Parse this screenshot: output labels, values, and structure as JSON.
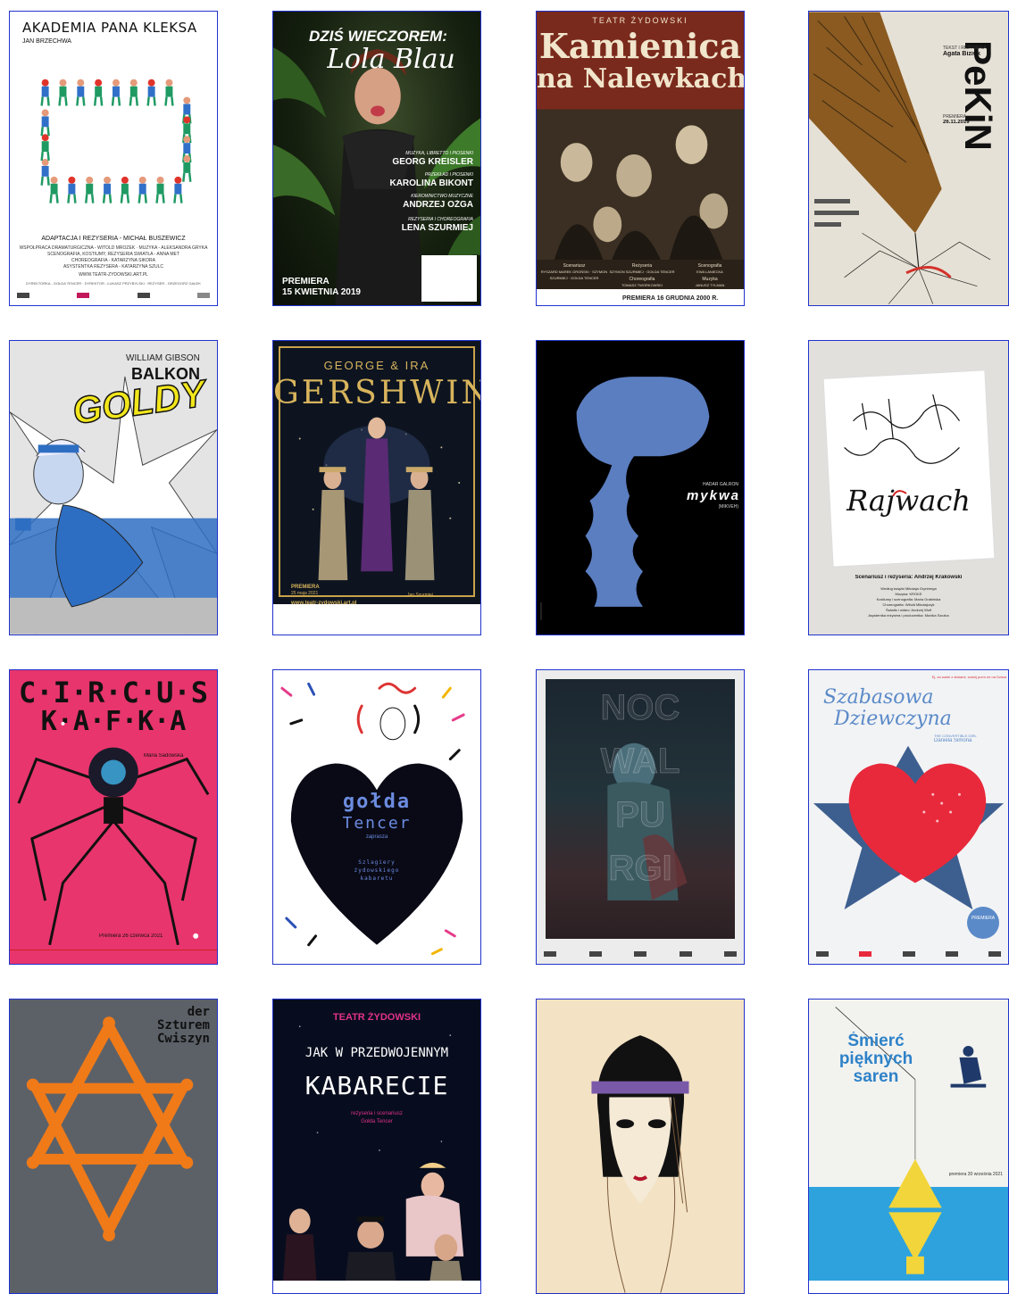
{
  "posters": [
    {
      "id": "akademia",
      "title": "AKADEMIA PANA KLEKSA",
      "author": "JAN BRZECHWA",
      "credit_main": "ADAPTACJA I REŻYSERIA - MICHAŁ BUSZEWICZ",
      "credit_lines": [
        "WSPÓŁPRACA DRAMATURGICZNA - WITOLD MROZEK · MUZYKA - ALEKSANDRA GRYKA",
        "SCENOGRAFIA, KOSTIUMY, REŻYSERIA ŚWIATŁA - ANNA MET",
        "CHOREOGRAFIA - KATARZYNA SIKORA",
        "ASYSTENTKA REŻYSERA - KATARZYNA SZULC",
        "WWW.TEATR-ZYDOWSKI.ART.PL"
      ],
      "footer": "DYREKTORKA - GOŁDA TENCER · DYREKTOR - ŁUKASZ PRZYBYLSKI · REŻYSER - GRZEGORZ GAŁEK"
    },
    {
      "id": "lola-blau",
      "title_line1": "DZIŚ WIECZOREM:",
      "title_line2": "Lola Blau",
      "credits": [
        {
          "role": "MUZYKA, LIBRETTO I PIOSENKI",
          "name": "GEORG KREISLER"
        },
        {
          "role": "PRZEKŁAD I PIOSENKI",
          "name": "KAROLINA BIKONT"
        },
        {
          "role": "KIEROWNICTWO MUZYCZNE",
          "name": "ANDRZEJ OŻGA"
        },
        {
          "role": "REŻYSERIA I CHOREOGRAFIA",
          "name": "LENA SZURMIEJ"
        }
      ],
      "premiere_label": "PREMIERA",
      "premiere_date": "15 KWIETNIA 2019"
    },
    {
      "id": "kamienica",
      "theatre": "TEATR ŻYDOWSKI",
      "title_line1": "Kamienica",
      "title_line2": "na Nalewkach",
      "credits": [
        {
          "role": "Scenariusz",
          "name": "RYSZARD MAREK GROŃSKI · SZYMON SZURMIEJ · GOŁDA TENCER"
        },
        {
          "role": "Reżyseria",
          "name": "SZYMON SZURMIEJ · GOŁDA TENCER"
        },
        {
          "role": "Scenografia",
          "name": "EWA LANIECKA"
        },
        {
          "role": "Choreografia",
          "name": "TOMASZ TWORKOWSKI"
        },
        {
          "role": "Muzyka",
          "name": "JANUSZ TYLMAN"
        }
      ],
      "premiere": "PREMIERA 16 GRUDNIA 2000 R."
    },
    {
      "id": "pekin",
      "title": "PeKiN",
      "credits_head": "TEKST I REŻYSERIA",
      "director": "Agata Biziuk",
      "premiere_label": "PREMIERA",
      "premiere_date": "26.11.2019"
    },
    {
      "id": "goldy",
      "author": "WILLIAM GIBSON",
      "title_line1": "BALKON",
      "title_line2": "GOLDY"
    },
    {
      "id": "gershwin",
      "title_top": "GEORGE & IRA",
      "title": "GERSHWIN",
      "premiere_label": "PREMIERA",
      "premiere_date": "25 maja 2021",
      "website": "www.teatr-zydowski.art.pl",
      "director": "Jan Szurmiej"
    },
    {
      "id": "mykwa",
      "author": "HADAR GALRON",
      "title": "mykwa",
      "subtitle": "(MIKVEH)"
    },
    {
      "id": "rajwach",
      "title": "Rajwach",
      "credit_main": "Scenariusz i reżyseria: Andrzej Krakowski",
      "credit_lines": [
        "Według książki Mikołaja Grynberga",
        "Muzyka: KROKE",
        "Kostiumy i scenografia: Maria Grabińska",
        "Choreografia: Witold Mikołajczyk",
        "Światło i wideo: Andrzej Wolf",
        "Asystentka reżysera i producentka: Monika Szczka"
      ]
    },
    {
      "id": "circus-kafka",
      "title_line1": "C·I·R·C·U·S",
      "title_line2": "K·A·F·K·A",
      "director": "Maria Sadowska",
      "premiere": "Premiera 26 czerwca 2021"
    },
    {
      "id": "golda",
      "name_line1": "gołda",
      "name_line2": "Tencer",
      "invites": "zaprasza",
      "subtitle_line1": "Szlagiery",
      "subtitle_line2": "żydowskiego",
      "subtitle_line3": "kabaretu"
    },
    {
      "id": "noc-walpurgi",
      "title_lines": [
        "NOC",
        "WAL",
        "PU",
        "RGI"
      ]
    },
    {
      "id": "szabasowa",
      "tagline": "Ej, za wami z siwiami, sośnij przm ne na Dziwa",
      "title_line1": "Szabasowa",
      "title_line2": "Dziewczyna",
      "subtitle": "THE CONVERTIBLE GIRL",
      "author": "Daniela Simona",
      "premiere": "PREMIERA"
    },
    {
      "id": "szturem",
      "title_line1": "der",
      "title_line2": "Szturem",
      "title_line3": "Cwiszyn"
    },
    {
      "id": "przedwojennym",
      "theatre": "TEATR ŻYDOWSKI",
      "title_line1": "JAK W PRZEDWOJENNYM",
      "title_line2": "KABARECIE",
      "credit_role": "reżyseria i scenariusz",
      "credit_name": "Gołda Tencer"
    },
    {
      "id": "portrait",
      "title": ""
    },
    {
      "id": "smierc",
      "title_line1": "Śmierć",
      "title_line2": "pięknych",
      "title_line3": "saren",
      "premiere": "premiera 30 września 2021"
    }
  ],
  "colors": {
    "frame_border": "#2233cc",
    "kleksa_green": "#1f9a63",
    "kleksa_red": "#e0342b",
    "pekin_bg": "#e6e1d6",
    "pekin_tower": "#8a5a21",
    "goldy_blue": "#2e6ec2",
    "goldy_yellow": "#f2e61c",
    "mykwa_blue": "#5b7ec0",
    "circus_pink": "#e8356d",
    "szturem_gray": "#5c6168",
    "szturem_orange": "#f07a18",
    "portrait_bg": "#f3e2c4",
    "smierc_blue": "#2ea2dd",
    "smierc_yellow": "#f2d53a"
  }
}
